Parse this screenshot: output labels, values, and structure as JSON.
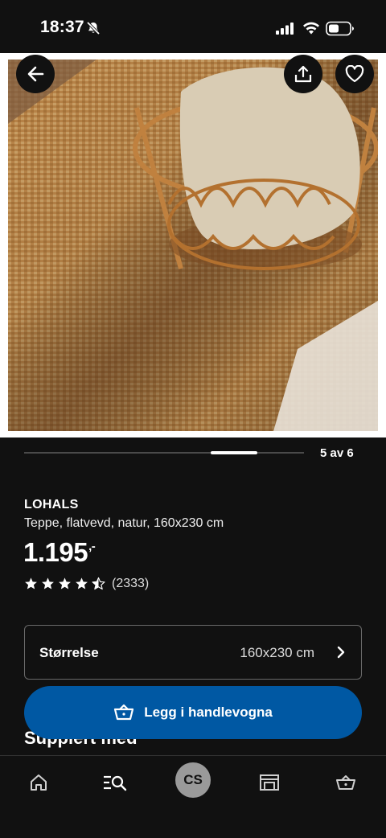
{
  "status_bar": {
    "time": "18:37"
  },
  "carousel": {
    "counter": "5 av 6",
    "current": 5,
    "total": 6
  },
  "product": {
    "name": "LOHALS",
    "description": "Teppe, flatvevd, natur, 160x230 cm",
    "price": "1.195",
    "price_suffix": ",-",
    "rating": 4.5,
    "rating_count": "(2333)"
  },
  "size_selector": {
    "label": "Størrelse",
    "value": "160x230 cm"
  },
  "section_heading": "Supplert med",
  "add_to_cart": {
    "label": "Legg i handlevogna"
  },
  "bottom_nav": {
    "profile_initials": "CS"
  },
  "colors": {
    "accent": "#0058a3",
    "background": "#111111"
  }
}
